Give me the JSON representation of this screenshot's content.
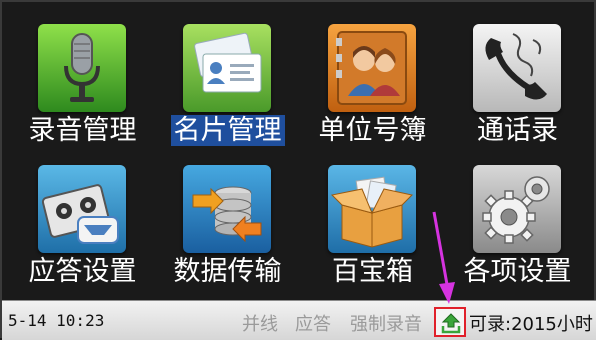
{
  "menu": {
    "items": [
      {
        "label": "录音管理",
        "icon": "microphone-icon"
      },
      {
        "label": "名片管理",
        "icon": "business-cards-icon",
        "selected": true
      },
      {
        "label": "单位号簿",
        "icon": "contacts-people-icon"
      },
      {
        "label": "通话录",
        "icon": "telephone-handset-icon"
      },
      {
        "label": "应答设置",
        "icon": "tape-recorder-icon"
      },
      {
        "label": "数据传输",
        "icon": "data-transfer-icon"
      },
      {
        "label": "百宝箱",
        "icon": "treasure-box-icon"
      },
      {
        "label": "各项设置",
        "icon": "gears-icon"
      }
    ]
  },
  "status": {
    "datetime": "5-14 10:23",
    "parallel": "并线",
    "answer": "应答",
    "force_record": "强制录音",
    "upload_icon": "upload-icon",
    "record_capacity": "可录:2015小时"
  },
  "colors": {
    "selection": "#1f4f9e",
    "highlight_border": "#e0202a",
    "arrow": "#d633e0",
    "upload_green": "#3aa53a"
  }
}
